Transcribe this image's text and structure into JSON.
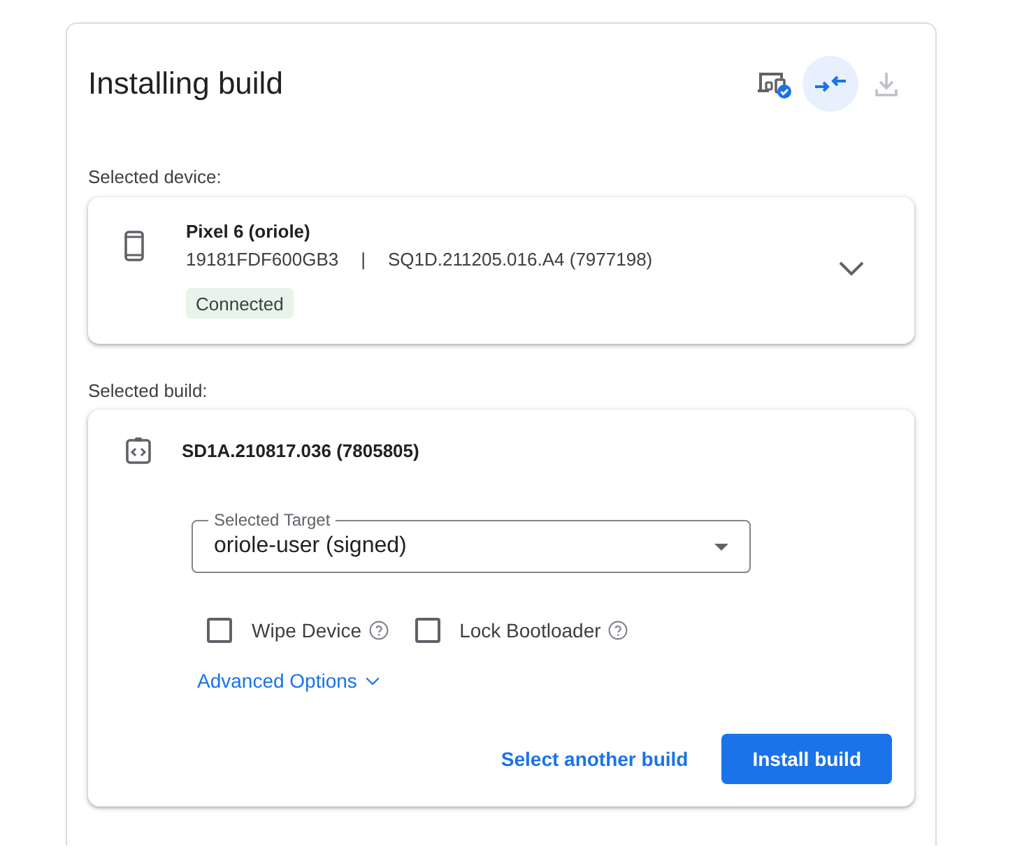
{
  "header": {
    "title": "Installing build",
    "actions": [
      {
        "kind": "device-check",
        "selected": false,
        "disabled": false
      },
      {
        "kind": "collapse",
        "selected": true,
        "disabled": false
      },
      {
        "kind": "download",
        "selected": false,
        "disabled": true
      }
    ]
  },
  "device_section": {
    "label": "Selected device:",
    "device": {
      "name": "Pixel 6 (oriole)",
      "serial": "19181FDF600GB3",
      "separator": "|",
      "build": "SQ1D.211205.016.A4 (7977198)",
      "status": "Connected",
      "expanded": false
    }
  },
  "build_section": {
    "label": "Selected build:",
    "build_id": "SD1A.210817.036 (7805805)",
    "target": {
      "label": "Selected Target",
      "value": "oriole-user (signed)"
    },
    "options": [
      {
        "label": "Wipe Device",
        "checked": false
      },
      {
        "label": "Lock Bootloader",
        "checked": false
      }
    ],
    "advanced": {
      "label": "Advanced Options",
      "expanded": false
    },
    "buttons": [
      {
        "kind": "text",
        "label": "Select another build"
      },
      {
        "kind": "filled",
        "label": "Install build"
      }
    ]
  }
}
